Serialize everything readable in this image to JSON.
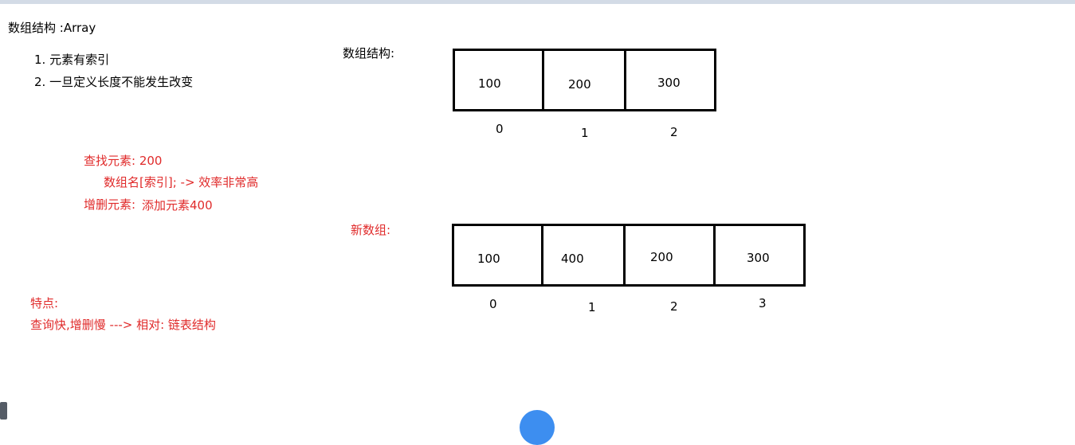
{
  "title": "数组结构 :Array",
  "features": [
    "1. 元素有索引",
    "2. 一旦定义长度不能发生改变"
  ],
  "lookup": {
    "line1": "查找元素:  200",
    "line2": "数组名[索引]; -> 效率非常高",
    "line3_label": "增删元素:",
    "line3_value": "添加元素400"
  },
  "summary": {
    "label": "特点:",
    "text": "查询快,增删慢   ---> 相对: 链表结构"
  },
  "array_label": "数组结构:",
  "array_values": [
    "100",
    "200",
    "300"
  ],
  "array_indices": [
    "0",
    "1",
    "2"
  ],
  "new_array_label": "新数组:",
  "new_array_values": [
    "100",
    "400",
    "200",
    "300"
  ],
  "new_array_indices": [
    "0",
    "1",
    "2",
    "3"
  ],
  "colors": {
    "red_text": "#e02b2b",
    "accent_button": "#3d8ef0"
  }
}
